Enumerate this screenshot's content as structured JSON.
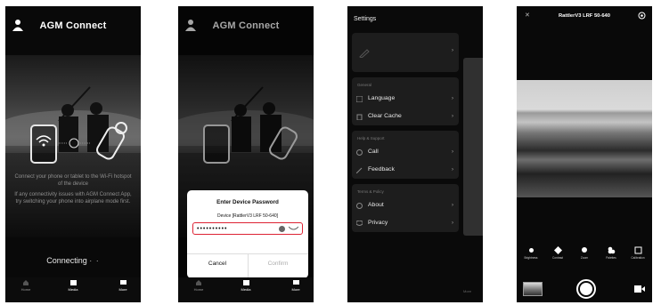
{
  "screen1": {
    "title": "AGM Connect",
    "message1": "Connect your phone or tablet to the Wi-Fi hotspot of the device",
    "message2": "If any connectivity issues with AGM Connect App, try switching your phone into airplane mode first.",
    "status": "Connecting",
    "status_dots": "· ·",
    "tabs": [
      "Home",
      "Media",
      "More"
    ]
  },
  "screen2": {
    "title": "AGM Connect",
    "dialog": {
      "title": "Enter Device Password",
      "device": "Device [RattlerV3 LRF 50-640]",
      "password_mask": "••••••••••",
      "cancel": "Cancel",
      "confirm": "Confirm"
    },
    "tabs": [
      "Home",
      "Media",
      "More"
    ]
  },
  "screen3": {
    "title": "Settings",
    "groups": [
      {
        "caption": "General",
        "items": [
          "Language",
          "Clear Cache"
        ]
      },
      {
        "caption": "Help & Support",
        "items": [
          "Call",
          "Feedback"
        ]
      },
      {
        "caption": "Terms & Policy",
        "items": [
          "About",
          "Privacy"
        ]
      }
    ],
    "peek_label": "More"
  },
  "screen4": {
    "title": "RattlerV3 LRF 50-640",
    "tools": [
      "Brightness",
      "Contrast",
      "Zoom",
      "Palettes",
      "Calibration"
    ]
  }
}
